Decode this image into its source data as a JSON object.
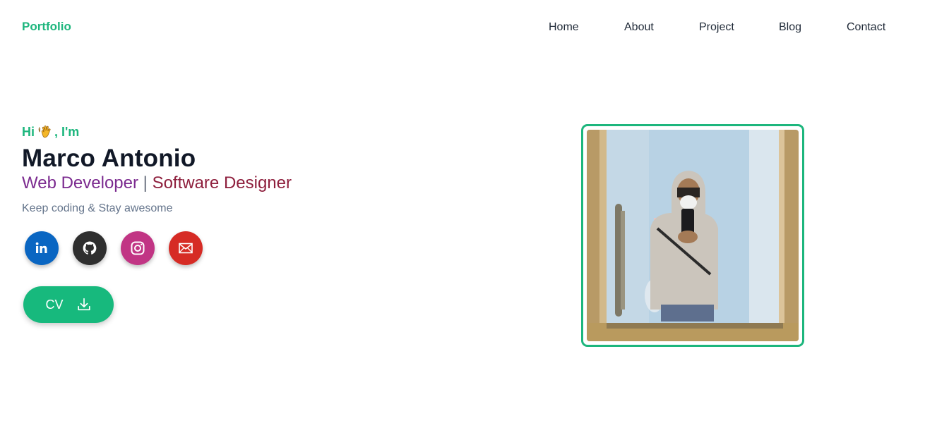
{
  "header": {
    "logo": "Portfolio",
    "nav": [
      "Home",
      "About",
      "Project",
      "Blog",
      "Contact"
    ]
  },
  "hero": {
    "greeting_hi": "Hi",
    "greeting_im": ", I'm",
    "wave_icon": "waving-hand-icon",
    "name": "Marco Antonio",
    "role_primary": "Web Developer",
    "role_separator": "|",
    "role_secondary": "Software Designer",
    "tagline": "Keep coding & Stay awesome",
    "cv_label": "CV"
  },
  "socials": [
    {
      "icon": "linkedin-icon",
      "color": "#0a66c2"
    },
    {
      "icon": "github-icon",
      "color": "#2f2f2f"
    },
    {
      "icon": "instagram-icon",
      "color": "#c13584"
    },
    {
      "icon": "email-icon",
      "color": "#d62b25"
    }
  ],
  "colors": {
    "accent": "#1db67d",
    "role_primary": "#7b2a8f",
    "role_secondary": "#8e1f3d"
  }
}
